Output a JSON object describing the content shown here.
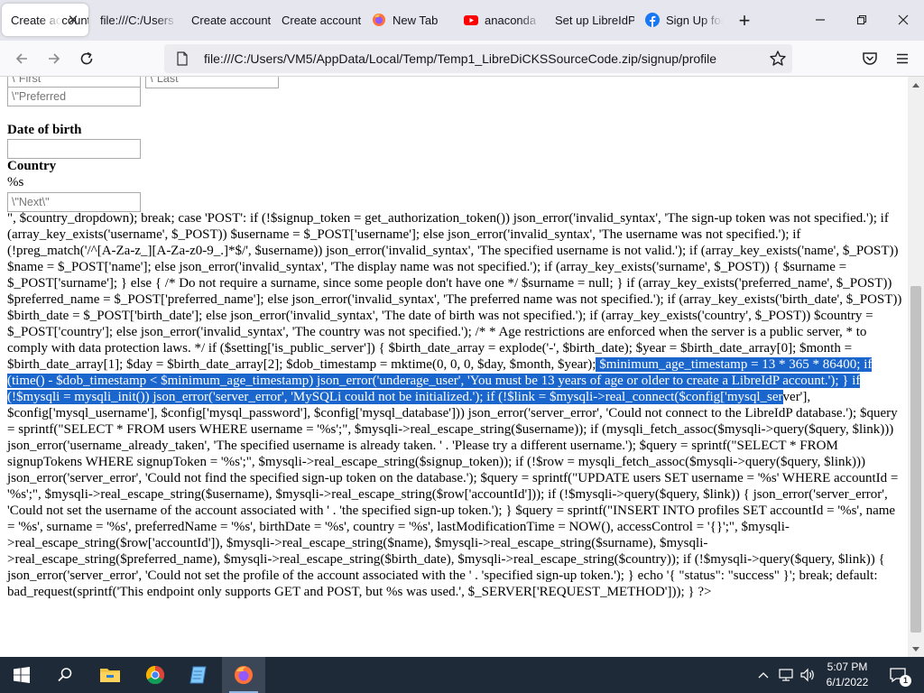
{
  "browser": {
    "tabs": [
      {
        "label": "Create account",
        "favicon": "none",
        "active": true
      },
      {
        "label": "file:///C:/Users",
        "favicon": "none",
        "active": false
      },
      {
        "label": "Create account",
        "favicon": "none",
        "active": false
      },
      {
        "label": "Create account",
        "favicon": "none",
        "active": false
      },
      {
        "label": "New Tab",
        "favicon": "firefox-icon",
        "active": false
      },
      {
        "label": "anaconda",
        "favicon": "youtube-icon",
        "active": false
      },
      {
        "label": "Set up LibreIdP",
        "favicon": "none",
        "active": false
      },
      {
        "label": "Sign Up for",
        "favicon": "facebook-icon",
        "active": false
      }
    ],
    "url": "file:///C:/Users/VM5/AppData/Local/Temp/Temp1_LibreDiCKSSourceCode.zip/signup/profile"
  },
  "page": {
    "placeholders": {
      "first": "\\\"First",
      "last": "\\\"Last",
      "preferred": "\\\"Preferred",
      "next": "\\\"Next\\\""
    },
    "date_of_birth_label": "Date of birth",
    "country_label": "Country",
    "format_text": "%s",
    "code_before_selection": "\", $country_dropdown); break; case 'POST': if (!$signup_token = get_authorization_token()) json_error('invalid_syntax', 'The sign-up token was not specified.'); if (array_key_exists('username', $_POST)) $username = $_POST['username']; else json_error('invalid_syntax', 'The username was not specified.'); if (!preg_match('/^[A-Za-z_][A-Za-z0-9_.]*$/', $username)) json_error('invalid_syntax', 'The specified username is not valid.'); if (array_key_exists('name', $_POST)) $name = $_POST['name']; else json_error('invalid_syntax', 'The display name was not specified.'); if (array_key_exists('surname', $_POST)) { $surname = $_POST['surname']; } else { /* Do not require a surname, since some people don't have one */ $surname = null; } if (array_key_exists('preferred_name', $_POST)) $preferred_name = $_POST['preferred_name']; else json_error('invalid_syntax', 'The preferred name was not specified.'); if (array_key_exists('birth_date', $_POST)) $birth_date = $_POST['birth_date']; else json_error('invalid_syntax', 'The date of birth was not specified.'); if (array_key_exists('country', $_POST)) $country = $_POST['country']; else json_error('invalid_syntax', 'The country was not specified.'); /* * Age restrictions are enforced when the server is a public server, * to comply with data protection laws. */ if ($setting['is_public_server']) { $birth_date_array = explode('-', $birth_date); $year = $birth_date_array[0]; $month = $birth_date_array[1]; $day = $birth_date_array[2]; $dob_timestamp = mktime(0, 0, 0, $day, $month, $year);",
    "code_selected": " $minimum_age_timestamp = 13 * 365 * 86400; if (time() - $dob_timestamp < $minimum_age_timestamp) json_error('underage_user', 'You must be 13 years of age or older to create a LibreIdP account.'); } if (!$mysqli = mysqli_init()) json_error('server_error', 'MySQLi could not be initialized.'); if (!$link = $mysqli->real_connect($config['mysql_ser",
    "code_after_selection": "ver'], $config['mysql_username'], $config['mysql_password'], $config['mysql_database'])) json_error('server_error', 'Could not connect to the LibreIdP database.'); $query = sprintf(\"SELECT * FROM users WHERE username = '%s';\", $mysqli->real_escape_string($username)); if (mysqli_fetch_assoc($mysqli->query($query, $link))) json_error('username_already_taken', 'The specified username is already taken. ' . 'Please try a different username.'); $query = sprintf(\"SELECT * FROM signupTokens WHERE signupToken = '%s';\", $mysqli->real_escape_string($signup_token)); if (!$row = mysqli_fetch_assoc($mysqli->query($query, $link))) json_error('server_error', 'Could not find the specified sign-up token on the database.'); $query = sprintf(\"UPDATE users SET username = '%s' WHERE accountId = '%s';\", $mysqli->real_escape_string($username), $mysqli->real_escape_string($row['accountId'])); if (!$mysqli->query($query, $link)) { json_error('server_error', 'Could not set the username of the account associated with ' . 'the specified sign-up token.'); } $query = sprintf(\"INSERT INTO profiles SET accountId = '%s', name = '%s', surname = '%s', preferredName = '%s', birthDate = '%s', country = '%s', lastModificationTime = NOW(), accessControl = '{}';\", $mysqli->real_escape_string($row['accountId']), $mysqli->real_escape_string($name), $mysqli->real_escape_string($surname), $mysqli->real_escape_string($preferred_name), $mysqli->real_escape_string($birth_date), $mysqli->real_escape_string($country)); if (!$mysqli->query($query, $link)) { json_error('server_error', 'Could not set the profile of the account associated with the ' . 'specified sign-up token.'); } echo '{ \"status\": \"success\" }'; break; default: bad_request(sprintf('This endpoint only supports GET and POST, but %s was used.', $_SERVER['REQUEST_METHOD'])); } ?>"
  },
  "taskbar": {
    "time": "5:07 PM",
    "date": "6/1/2022",
    "notification_count": "1",
    "pinned": [
      "start-icon",
      "search-icon",
      "file-explorer-icon",
      "chrome-icon",
      "notepad-icon",
      "firefox-icon"
    ]
  },
  "colors": {
    "selection": "#1a66cc",
    "tabstrip": "#e6e6ee",
    "taskbar": "#1f2a38"
  }
}
